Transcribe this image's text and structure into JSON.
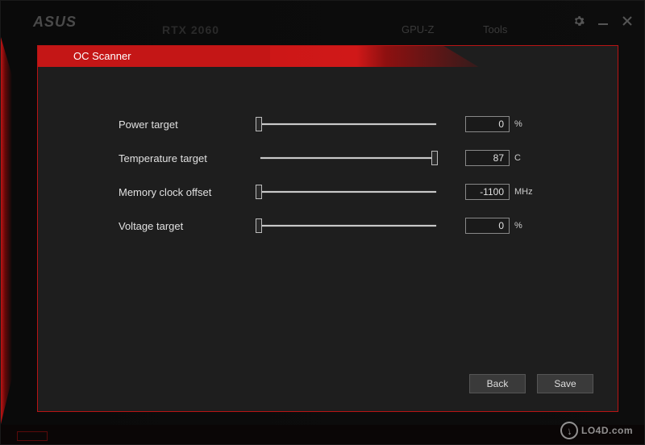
{
  "brand": "ASUS",
  "gpu_model": "RTX 2060",
  "bg_tabs": {
    "gpuz": "GPU-Z",
    "tools": "Tools"
  },
  "panel": {
    "title": "OC Scanner"
  },
  "sliders": [
    {
      "label": "Power target",
      "value": "0",
      "unit": "%",
      "thumb_pct": 0
    },
    {
      "label": "Temperature target",
      "value": "87",
      "unit": "C",
      "thumb_pct": 100
    },
    {
      "label": "Memory clock offset",
      "value": "-1100",
      "unit": "MHz",
      "thumb_pct": 0
    },
    {
      "label": "Voltage target",
      "value": "0",
      "unit": "%",
      "thumb_pct": 0
    }
  ],
  "buttons": {
    "back": "Back",
    "save": "Save"
  },
  "watermark": "LO4D.com"
}
